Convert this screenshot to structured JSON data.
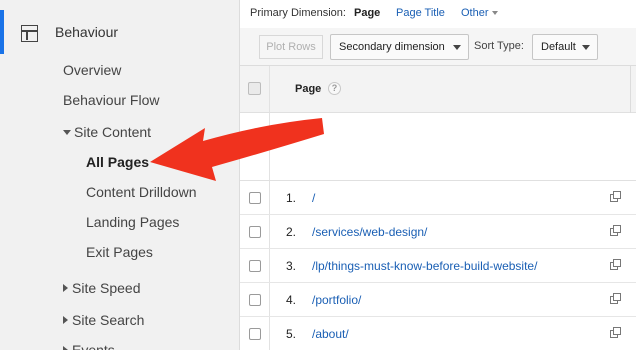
{
  "sidebar": {
    "section_title": "Behaviour",
    "items": [
      {
        "label": "Overview"
      },
      {
        "label": "Behaviour Flow"
      },
      {
        "label": "Site Content"
      },
      {
        "label": "All Pages"
      },
      {
        "label": "Content Drilldown"
      },
      {
        "label": "Landing Pages"
      },
      {
        "label": "Exit Pages"
      },
      {
        "label": "Site Speed"
      },
      {
        "label": "Site Search"
      },
      {
        "label": "Events"
      }
    ]
  },
  "primary_dimension": {
    "label": "Primary Dimension:",
    "options": [
      "Page",
      "Page Title",
      "Other"
    ],
    "selected": "Page"
  },
  "toolbar": {
    "plot_rows": "Plot Rows",
    "secondary_dimension": "Secondary dimension",
    "sort_type_label": "Sort Type:",
    "sort_type_value": "Default"
  },
  "table": {
    "column_header": "Page",
    "help_glyph": "?",
    "rows": [
      {
        "num": "1.",
        "page": "/"
      },
      {
        "num": "2.",
        "page": "/services/web-design/"
      },
      {
        "num": "3.",
        "page": "/lp/things-must-know-before-build-website/"
      },
      {
        "num": "4.",
        "page": "/portfolio/"
      },
      {
        "num": "5.",
        "page": "/about/"
      }
    ]
  },
  "colors": {
    "accent": "#1a73e8",
    "link": "#1a5fb4",
    "arrow": "#f0321e"
  }
}
